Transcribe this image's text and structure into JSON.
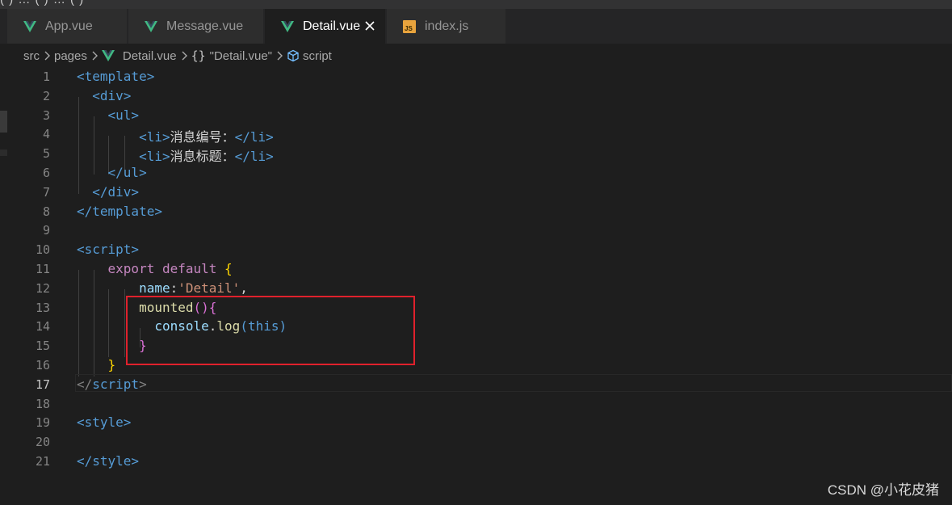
{
  "topstrip": {
    "text": "(  )  …  (  )  …  (  )"
  },
  "tabs": [
    {
      "label": "App.vue",
      "icon": "vue-icon",
      "active": false
    },
    {
      "label": "Message.vue",
      "icon": "vue-icon",
      "active": false
    },
    {
      "label": "Detail.vue",
      "icon": "vue-icon",
      "active": true
    },
    {
      "label": "index.js",
      "icon": "js-icon",
      "active": false
    }
  ],
  "js_icon_text": "JS",
  "breadcrumb": {
    "items": [
      "src",
      "pages",
      "Detail.vue",
      "\"Detail.vue\"",
      "script"
    ]
  },
  "editor": {
    "current_line": 17,
    "lines": [
      {
        "num": "1",
        "tokens": [
          [
            "tag",
            "<template>"
          ]
        ]
      },
      {
        "num": "2",
        "tokens": [
          [
            "txt",
            "  "
          ],
          [
            "tag",
            "<div>"
          ]
        ]
      },
      {
        "num": "3",
        "tokens": [
          [
            "txt",
            "    "
          ],
          [
            "tag",
            "<ul>"
          ]
        ]
      },
      {
        "num": "4",
        "tokens": [
          [
            "txt",
            "        "
          ],
          [
            "tag",
            "<li>"
          ],
          [
            "txt",
            "消息编号："
          ],
          [
            "tag",
            "</li>"
          ]
        ]
      },
      {
        "num": "5",
        "tokens": [
          [
            "txt",
            "        "
          ],
          [
            "tag",
            "<li>"
          ],
          [
            "txt",
            "消息标题："
          ],
          [
            "tag",
            "</li>"
          ]
        ]
      },
      {
        "num": "6",
        "tokens": [
          [
            "txt",
            "    "
          ],
          [
            "tag",
            "</ul>"
          ]
        ]
      },
      {
        "num": "7",
        "tokens": [
          [
            "txt",
            "  "
          ],
          [
            "tag",
            "</div>"
          ]
        ]
      },
      {
        "num": "8",
        "tokens": [
          [
            "tag",
            "</template>"
          ]
        ]
      },
      {
        "num": "9",
        "tokens": []
      },
      {
        "num": "10",
        "tokens": [
          [
            "tag",
            "<script>"
          ]
        ]
      },
      {
        "num": "11",
        "tokens": [
          [
            "txt",
            "    "
          ],
          [
            "kw",
            "export"
          ],
          [
            "txt",
            " "
          ],
          [
            "kw",
            "default"
          ],
          [
            "txt",
            " "
          ],
          [
            "brace",
            "{"
          ]
        ]
      },
      {
        "num": "12",
        "tokens": [
          [
            "txt",
            "        "
          ],
          [
            "prop",
            "name"
          ],
          [
            "txt",
            ":"
          ],
          [
            "str",
            "'Detail'"
          ],
          [
            "txt",
            ","
          ]
        ]
      },
      {
        "num": "13",
        "tokens": [
          [
            "txt",
            "        "
          ],
          [
            "fn",
            "mounted"
          ],
          [
            "brace2",
            "()"
          ],
          [
            "brace2",
            "{"
          ]
        ]
      },
      {
        "num": "14",
        "tokens": [
          [
            "txt",
            "          "
          ],
          [
            "var",
            "console"
          ],
          [
            "txt",
            "."
          ],
          [
            "fn",
            "log"
          ],
          [
            "kwb",
            "("
          ],
          [
            "kwb",
            "this"
          ],
          [
            "kwb",
            ")"
          ]
        ]
      },
      {
        "num": "15",
        "tokens": [
          [
            "txt",
            "        "
          ],
          [
            "brace2",
            "}"
          ]
        ]
      },
      {
        "num": "16",
        "tokens": [
          [
            "txt",
            "    "
          ],
          [
            "brace",
            "}"
          ]
        ]
      },
      {
        "num": "17",
        "tokens": [
          [
            "punc",
            "</"
          ],
          [
            "tag",
            "script"
          ],
          [
            "punc",
            ">"
          ]
        ]
      },
      {
        "num": "18",
        "tokens": []
      },
      {
        "num": "19",
        "tokens": [
          [
            "tag",
            "<style>"
          ]
        ]
      },
      {
        "num": "20",
        "tokens": []
      },
      {
        "num": "21",
        "tokens": [
          [
            "tag",
            "</style>"
          ]
        ]
      }
    ]
  },
  "watermark": "CSDN @小花皮猪",
  "colors": {
    "background": "#1e1e1e",
    "tab_inactive": "#2d2d2d",
    "highlight_box": "#e0212c",
    "vue_icon": "#41b883"
  }
}
